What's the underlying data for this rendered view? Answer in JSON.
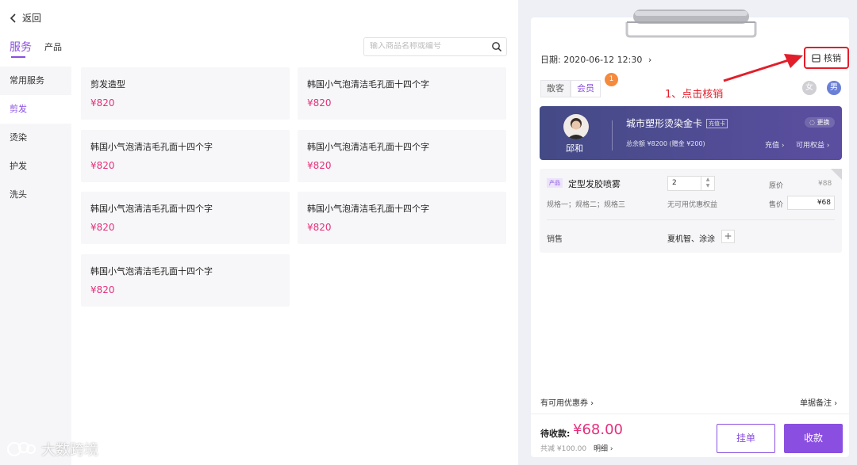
{
  "header": {
    "back_label": "返回"
  },
  "tabs": [
    {
      "label": "服务",
      "active": true
    },
    {
      "label": "产品",
      "active": false
    }
  ],
  "search": {
    "placeholder": "输入商品名称或编号"
  },
  "sidebar": {
    "items": [
      {
        "label": "常用服务",
        "active": false
      },
      {
        "label": "剪发",
        "active": true
      },
      {
        "label": "烫染",
        "active": false
      },
      {
        "label": "护发",
        "active": false
      },
      {
        "label": "洗头",
        "active": false
      }
    ]
  },
  "products": [
    {
      "name": "剪发造型",
      "price": "¥820"
    },
    {
      "name": "韩国小气泡清洁毛孔面十四个字",
      "price": "¥820"
    },
    {
      "name": "韩国小气泡清洁毛孔面十四个字",
      "price": "¥820"
    },
    {
      "name": "韩国小气泡清洁毛孔面十四个字",
      "price": "¥820"
    },
    {
      "name": "韩国小气泡清洁毛孔面十四个字",
      "price": "¥820"
    },
    {
      "name": "韩国小气泡清洁毛孔面十四个字",
      "price": "¥820"
    },
    {
      "name": "韩国小气泡清洁毛孔面十四个字",
      "price": "¥820"
    }
  ],
  "order": {
    "date_label": "日期:",
    "date_value": "2020-06-12 12:30",
    "verify_label": "核销",
    "annotation": "1、点击核销",
    "customer_types": {
      "guest": "散客",
      "member": "会员"
    },
    "member_badge": "1",
    "gender": {
      "female": "女",
      "male": "男"
    },
    "member": {
      "name": "邱和",
      "card_name": "城市塑形烫染金卡",
      "card_tag": "充值卡",
      "switch_label": "更换",
      "balance": "总余额 ¥8200 (赠金 ¥200)",
      "recharge": "充值 ›",
      "benefits": "可用权益 ›"
    },
    "item": {
      "tag": "产品",
      "name": "定型发胶喷雾",
      "quantity": "2",
      "original_price_label": "原价",
      "original_price": "¥88",
      "specs": "规格一；规格二；规格三",
      "no_discount": "无可用优惠权益",
      "sale_price_label": "售价",
      "sale_price": "¥68",
      "seller_label": "销售",
      "sellers": "夏机智、涂涂"
    },
    "coupons_label": "有可用优惠券 ›",
    "remark_label": "单据备注 ›",
    "due_label": "待收款:",
    "due_amount": "¥68.00",
    "total_line": "共减 ¥100.00",
    "detail_label": "明细 ›",
    "hold_label": "挂单",
    "pay_label": "收款"
  },
  "watermark": {
    "text": "大数跨境"
  },
  "colors": {
    "accent": "#8a4fe0",
    "price": "#e5307c",
    "annotation": "#e21e2a"
  }
}
